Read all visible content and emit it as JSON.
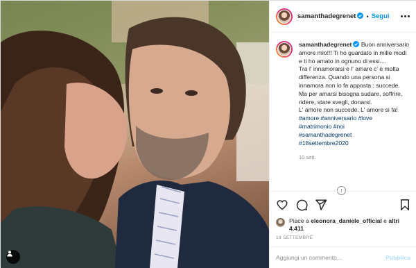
{
  "post": {
    "username": "samanthadegrenet",
    "follow_label": "Segui",
    "separator": "•",
    "caption_username": "samanthadegrenet",
    "caption_lines": [
      "Buon anniversario amore mio!!! Ti ho guardato in mille modi e ti ho amato in ognuno di essi....",
      "Tra l' innamorarsi e l' amare c' è molta differenza. Quando una persona si innamora non lo fa apposta : succede.",
      "Ma per amarsi bisogna sudare, soffrire, ridere, stare svegli, donarsi.",
      "L' amore non succede. L' amore si fa!"
    ],
    "hashtags": [
      "#amore #anniversario #love",
      "#matrimonio #noi",
      "#samanthadegrenet",
      "#18settembre2020"
    ],
    "time_ago": "10 sett.",
    "likes_prefix": "Piace a ",
    "likes_user": "eleonora_daniele_official",
    "likes_middle": " e ",
    "likes_count": "altri 4.411",
    "date": "18 SETTEMBRE"
  },
  "comment": {
    "placeholder": "Aggiungi un commento...",
    "publish_label": "Pubblica"
  },
  "icons": {
    "verified": "verified-badge-icon",
    "more": "more-options-icon",
    "like": "heart-icon",
    "comment": "comment-icon",
    "share": "share-icon",
    "save": "bookmark-icon",
    "load_more": "load-more-icon",
    "user_tags": "user-tag-icon"
  },
  "colors": {
    "link": "#0095f6",
    "hashtag": "#00376b",
    "muted": "#8e8e8e",
    "text": "#262626",
    "border": "#efefef",
    "publish_disabled": "#b2dffc"
  }
}
